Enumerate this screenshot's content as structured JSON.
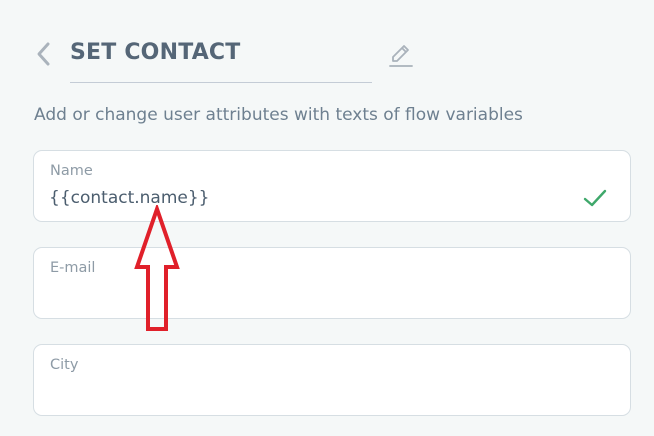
{
  "header": {
    "title": "SET CONTACT",
    "back_icon": "chevron-left-icon",
    "edit_icon": "pencil-icon"
  },
  "description": "Add or change user attributes with texts of flow variables",
  "fields": [
    {
      "label": "Name",
      "value": "{{contact.name}}",
      "status_icon": "check-icon",
      "status_color": "#3fa86b"
    },
    {
      "label": "E-mail",
      "value": ""
    },
    {
      "label": "City",
      "value": ""
    }
  ],
  "annotation": {
    "icon": "arrow-up-icon",
    "color": "#e0202a"
  }
}
